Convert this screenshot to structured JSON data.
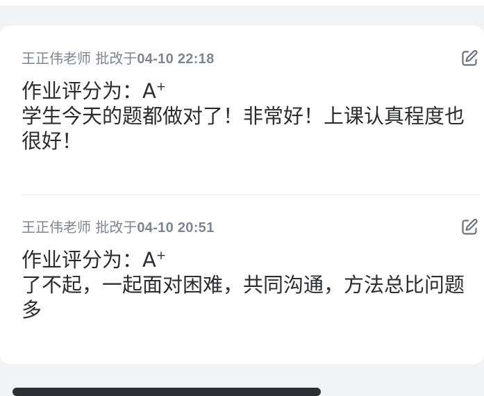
{
  "records": [
    {
      "teacher": "王正伟老师",
      "corrected_prefix": "批改于",
      "time": "04-10 22:18",
      "grade_prefix": "作业评分为：",
      "grade_letter": "A",
      "grade_mark": "+",
      "comment": "学生今天的题都做对了！非常好！上课认真程度也很好！"
    },
    {
      "teacher": "王正伟老师",
      "corrected_prefix": "批改于",
      "time": "04-10 20:51",
      "grade_prefix": "作业评分为：",
      "grade_letter": "A",
      "grade_mark": "+",
      "comment": "了不起，一起面对困难，共同沟通，方法总比问题多"
    }
  ],
  "icons": {
    "edit": "edit-icon"
  },
  "colors": {
    "background": "#f2f3f5",
    "card": "#ffffff",
    "meta_text": "#7f8590",
    "body_text": "#2a2c30",
    "divider": "#e6e7ea"
  }
}
